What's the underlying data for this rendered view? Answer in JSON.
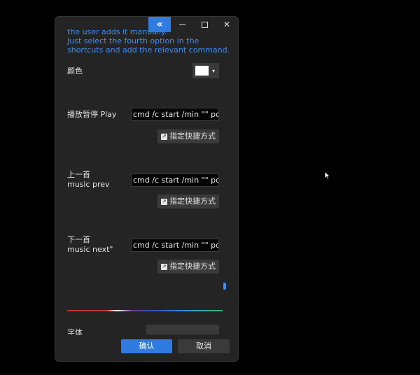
{
  "titlebar": {
    "collapse_glyph": "«",
    "close_glyph": "✕"
  },
  "hint": {
    "text": "the user adds it manually.\nJust select the fourth option in the shortcuts and add the relevant command."
  },
  "color_setting": {
    "label": "颜色",
    "value": "#ffffff",
    "caret": "▾"
  },
  "commands": [
    {
      "label": "播放暂停 Play",
      "command": "cmd /c start /min \"\" powershell",
      "button_label": "指定快捷方式"
    },
    {
      "label": "上一首\nmusic prev",
      "command": "cmd /c start /min \"\" powershell",
      "button_label": "指定快捷方式"
    },
    {
      "label": "下一首\nmusic next\"",
      "command": "cmd /c start /min \"\" powershell",
      "button_label": "指定快捷方式"
    }
  ],
  "cut_label": "字体",
  "footer": {
    "ok_label": "确认",
    "cancel_label": "取消"
  },
  "colors": {
    "accent": "#2f7be0",
    "hint_text": "#3d8ff5",
    "window_bg": "#242424",
    "button_bg": "#3a3a3a"
  }
}
